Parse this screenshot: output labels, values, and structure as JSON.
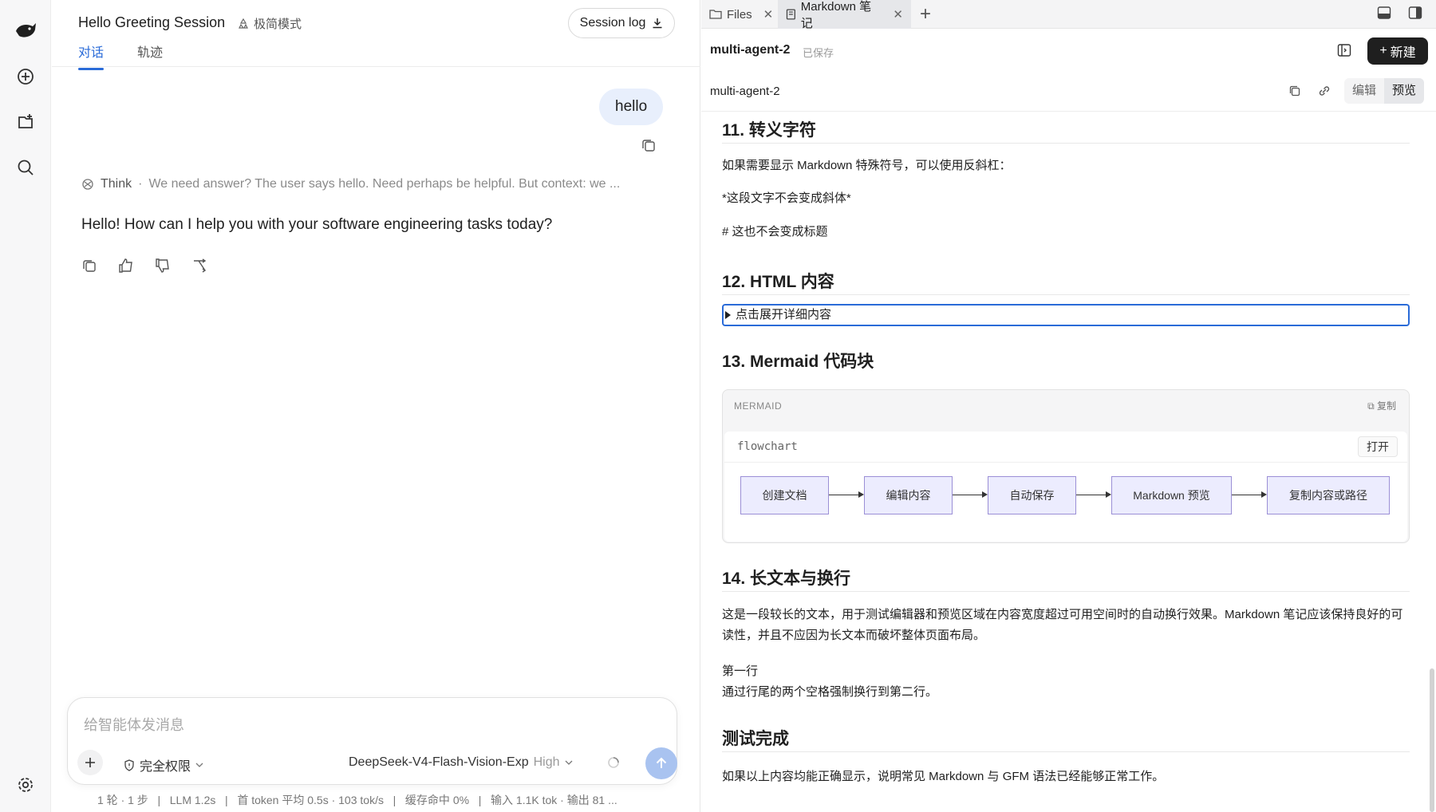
{
  "chat": {
    "session_title": "Hello Greeting Session",
    "mode_label": "极简模式",
    "session_log_label": "Session log",
    "tabs": [
      {
        "label": "对话",
        "active": true
      },
      {
        "label": "轨迹",
        "active": false
      }
    ],
    "user_message": "hello",
    "think_label": "Think",
    "think_preview": "We need answer? The user says hello. Need perhaps be helpful. But context: we ...",
    "assistant_message": "Hello! How can I help you with your software engineering tasks today?",
    "composer": {
      "placeholder": "给智能体发消息",
      "permission_label": "完全权限",
      "model_name": "DeepSeek-V4-Flash-Vision-Exp",
      "model_level": "High"
    },
    "status_line": "1 轮 · 1 步   |   LLM 1.2s   |   首 token 平均 0.5s · 103 tok/s   |   缓存命中 0%   |   输入 1.1K tok · 输出 81 ..."
  },
  "editor": {
    "tabs": [
      {
        "label": "Files",
        "icon": "folder-icon",
        "active": false
      },
      {
        "label": "Markdown 笔记",
        "icon": "note-icon",
        "active": true
      }
    ],
    "doc_name": "multi-agent-2",
    "saved_label": "已保存",
    "new_label": "新建",
    "sub_name": "multi-agent-2",
    "edit_label": "编辑",
    "preview_label": "预览",
    "sections": {
      "s11_title": "11. 转义字符",
      "s11_p1": "如果需要显示 Markdown 特殊符号，可以使用反斜杠：",
      "s11_p2": "*这段文字不会变成斜体*",
      "s11_p3": "# 这也不会变成标题",
      "s12_title": "12. HTML 内容",
      "s12_details": "点击展开详细内容",
      "s13_title": "13. Mermaid 代码块",
      "s14_title": "14. 长文本与换行",
      "s14_p1": "这是一段较长的文本，用于测试编辑器和预览区域在内容宽度超过可用空间时的自动换行效果。Markdown 笔记应该保持良好的可读性，并且不应因为长文本而破坏整体页面布局。",
      "s14_p2a": "第一行",
      "s14_p2b": "通过行尾的两个空格强制换行到第二行。",
      "done_title": "测试完成",
      "done_p": "如果以上内容均能正确显示，说明常见 Markdown 与 GFM 语法已经能够正常工作。"
    },
    "mermaid": {
      "lang_label": "MERMAID",
      "copy_label": "复制",
      "code": "flowchart",
      "open_label": "打开",
      "nodes": [
        "创建文档",
        "编辑内容",
        "自动保存",
        "Markdown 预览",
        "复制内容或路径"
      ]
    }
  },
  "colors": {
    "accent": "#2a6bd8",
    "user_bubble": "#e8effc",
    "send_button": "#a9c3f0",
    "node_fill": "#ececfe",
    "node_border": "#9b8fd6"
  }
}
